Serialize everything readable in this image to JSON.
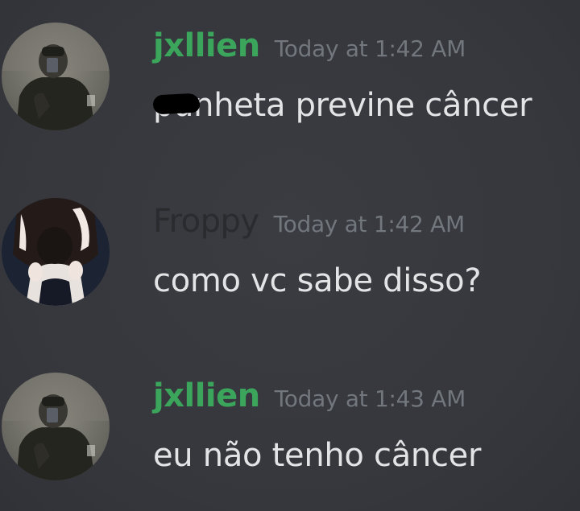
{
  "colors": {
    "background": "#37393f",
    "text": "#e3e4e6",
    "timestamp": "#72767d",
    "green_user": "#3ba55c",
    "dark_user": "#2a2b2e"
  },
  "messages": [
    {
      "username": "jxllien",
      "username_color": "#3ba55c",
      "timestamp": "Today at 1:42 AM",
      "text": "punheta previne câncer",
      "avatar_icon": "avatar-photo-person-icon"
    },
    {
      "username": "Froppy",
      "username_color": "#2a2b2e",
      "timestamp": "Today at 1:42 AM",
      "text": "como vc  sabe disso?",
      "avatar_icon": "avatar-anime-icon"
    },
    {
      "username": "jxllien",
      "username_color": "#3ba55c",
      "timestamp": "Today at 1:43 AM",
      "text": "eu não tenho câncer",
      "avatar_icon": "avatar-photo-person-icon"
    }
  ]
}
